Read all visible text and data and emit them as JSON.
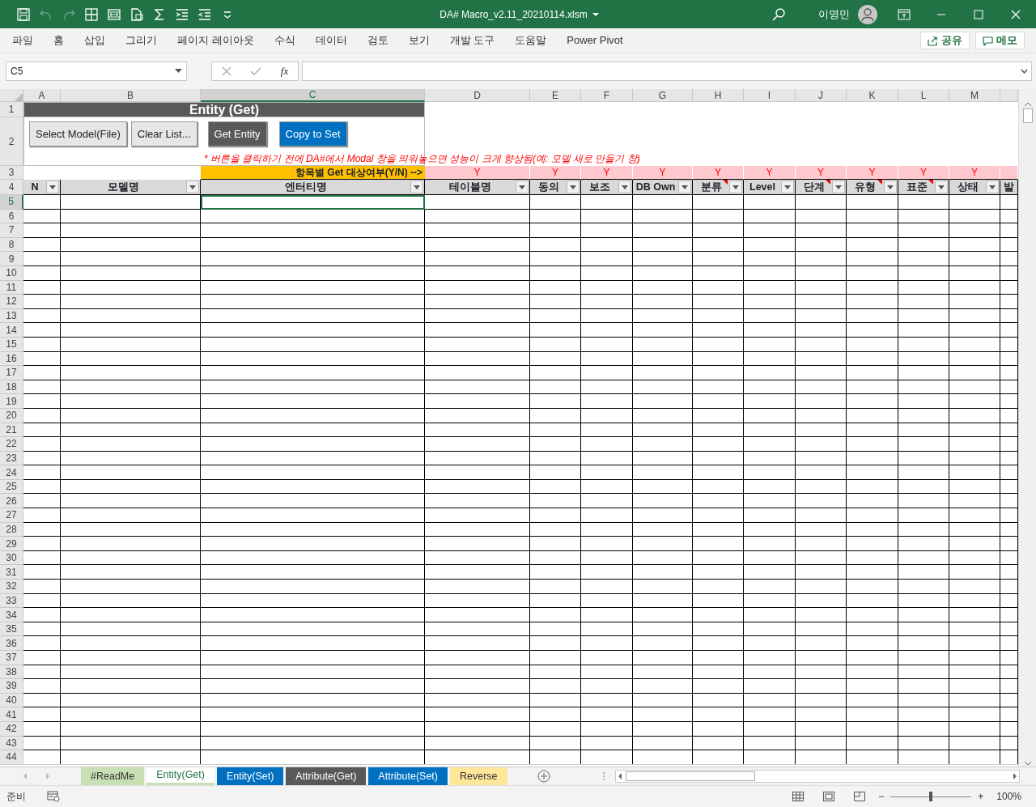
{
  "window": {
    "title": "DA# Macro_v2.11_20210114.xlsm",
    "user": "이영민"
  },
  "quick_access": [
    {
      "kind": "save",
      "disabled": false
    },
    {
      "kind": "undo",
      "disabled": true
    },
    {
      "kind": "redo",
      "disabled": true
    },
    {
      "kind": "table",
      "disabled": false
    },
    {
      "kind": "frame",
      "disabled": false
    },
    {
      "kind": "document",
      "disabled": false
    },
    {
      "kind": "sum",
      "disabled": false
    },
    {
      "kind": "indent",
      "disabled": false
    },
    {
      "kind": "outdent",
      "disabled": false
    },
    {
      "kind": "customize",
      "disabled": false
    }
  ],
  "ribbon": {
    "tabs": [
      {
        "label": "파일"
      },
      {
        "label": "홈"
      },
      {
        "label": "삽입"
      },
      {
        "label": "그리기"
      },
      {
        "label": "페이지 레이아웃"
      },
      {
        "label": "수식"
      },
      {
        "label": "데이터"
      },
      {
        "label": "검토"
      },
      {
        "label": "보기"
      },
      {
        "label": "개발 도구"
      },
      {
        "label": "도움말"
      },
      {
        "label": "Power Pivot"
      }
    ],
    "share": "공유",
    "comments": "메모"
  },
  "formula_bar": {
    "name_box": "C5",
    "fx": "fx"
  },
  "sheet": {
    "column_letters": [
      {
        "label": "A",
        "selected": false
      },
      {
        "label": "B",
        "selected": false
      },
      {
        "label": "C",
        "selected": true
      },
      {
        "label": "D",
        "selected": false
      },
      {
        "label": "E",
        "selected": false
      },
      {
        "label": "F",
        "selected": false
      },
      {
        "label": "G",
        "selected": false
      },
      {
        "label": "H",
        "selected": false
      },
      {
        "label": "I",
        "selected": false
      },
      {
        "label": "J",
        "selected": false
      },
      {
        "label": "K",
        "selected": false
      },
      {
        "label": "L",
        "selected": false
      },
      {
        "label": "M",
        "selected": false
      }
    ],
    "row_numbers": [
      {
        "label": "1",
        "selected": false
      },
      {
        "label": "2",
        "selected": false
      },
      {
        "label": "3",
        "selected": false
      },
      {
        "label": "4",
        "selected": false
      },
      {
        "label": "5",
        "selected": true
      },
      {
        "label": "6",
        "selected": false
      },
      {
        "label": "7",
        "selected": false
      },
      {
        "label": "8",
        "selected": false
      },
      {
        "label": "9",
        "selected": false
      },
      {
        "label": "10",
        "selected": false
      },
      {
        "label": "11",
        "selected": false
      },
      {
        "label": "12",
        "selected": false
      },
      {
        "label": "13",
        "selected": false
      },
      {
        "label": "14",
        "selected": false
      },
      {
        "label": "15",
        "selected": false
      },
      {
        "label": "16",
        "selected": false
      },
      {
        "label": "17",
        "selected": false
      },
      {
        "label": "18",
        "selected": false
      },
      {
        "label": "19",
        "selected": false
      },
      {
        "label": "20",
        "selected": false
      },
      {
        "label": "21",
        "selected": false
      },
      {
        "label": "22",
        "selected": false
      },
      {
        "label": "23",
        "selected": false
      },
      {
        "label": "24",
        "selected": false
      },
      {
        "label": "25",
        "selected": false
      },
      {
        "label": "26",
        "selected": false
      },
      {
        "label": "27",
        "selected": false
      },
      {
        "label": "28",
        "selected": false
      },
      {
        "label": "29",
        "selected": false
      },
      {
        "label": "30",
        "selected": false
      },
      {
        "label": "31",
        "selected": false
      },
      {
        "label": "32",
        "selected": false
      },
      {
        "label": "33",
        "selected": false
      },
      {
        "label": "34",
        "selected": false
      },
      {
        "label": "35",
        "selected": false
      },
      {
        "label": "36",
        "selected": false
      },
      {
        "label": "37",
        "selected": false
      },
      {
        "label": "38",
        "selected": false
      },
      {
        "label": "39",
        "selected": false
      },
      {
        "label": "40",
        "selected": false
      },
      {
        "label": "41",
        "selected": false
      },
      {
        "label": "42",
        "selected": false
      },
      {
        "label": "43",
        "selected": false
      },
      {
        "label": "44",
        "selected": false
      }
    ],
    "title": "Entity (Get)",
    "buttons": [
      {
        "label": "Select Model(File)",
        "color": "#e7e6e6"
      },
      {
        "label": "Clear List...",
        "color": "#e7e6e6"
      },
      {
        "label": "Get Entity",
        "color": "#595959"
      },
      {
        "label": "Copy to Set",
        "color": "#0070c0"
      }
    ],
    "note": "* 버튼을 클릭하기 전에 DA#에서 Modal 창을 띄워놓으면 성능이 크게 향상됨(예: 모델 새로 만들기 창)",
    "flag_label": "항목별 Get 대상여부(Y/N) -->",
    "columns": [
      {
        "heading": "N",
        "filter": true,
        "comment": false
      },
      {
        "heading": "모델명",
        "filter": true,
        "comment": false
      },
      {
        "heading": "엔터티명",
        "filter": true,
        "comment": false
      },
      {
        "heading": "테이블명",
        "flag": "Y",
        "filter": true,
        "comment": false
      },
      {
        "heading": "동의",
        "flag": "Y",
        "filter": true,
        "comment": false
      },
      {
        "heading": "보조",
        "flag": "Y",
        "filter": true,
        "comment": false
      },
      {
        "heading": "DB Own",
        "flag": "Y",
        "filter": true,
        "comment": false
      },
      {
        "heading": "분류",
        "flag": "Y",
        "filter": true,
        "comment": true
      },
      {
        "heading": "Level",
        "flag": "Y",
        "filter": true,
        "comment": false
      },
      {
        "heading": "단계",
        "flag": "Y",
        "filter": true,
        "comment": true
      },
      {
        "heading": "유형",
        "flag": "Y",
        "filter": true,
        "comment": true
      },
      {
        "heading": "표준",
        "flag": "Y",
        "filter": true,
        "comment": true
      },
      {
        "heading": "상태",
        "flag": "Y",
        "filter": true,
        "comment": false
      },
      {
        "heading": "발",
        "filter": false,
        "comment": false
      }
    ]
  },
  "sheet_tabs": [
    {
      "label": "#ReadMe",
      "color": "#c6e0b4",
      "selected": false
    },
    {
      "label": "Entity(Get)",
      "color": "#c6e0b4",
      "selected": true
    },
    {
      "label": "Entity(Set)",
      "color": "#0070c0",
      "selected": false
    },
    {
      "label": "Attribute(Get)",
      "color": "#595959",
      "selected": false
    },
    {
      "label": "Attribute(Set)",
      "color": "#0070c0",
      "selected": false
    },
    {
      "label": "Reverse",
      "color": "#ffe699",
      "selected": false
    }
  ],
  "status_bar": {
    "text": "준비",
    "zoom_out": "−",
    "zoom_in": "+",
    "zoom_slider": {
      "level": 0.5
    },
    "zoom": "100%"
  }
}
